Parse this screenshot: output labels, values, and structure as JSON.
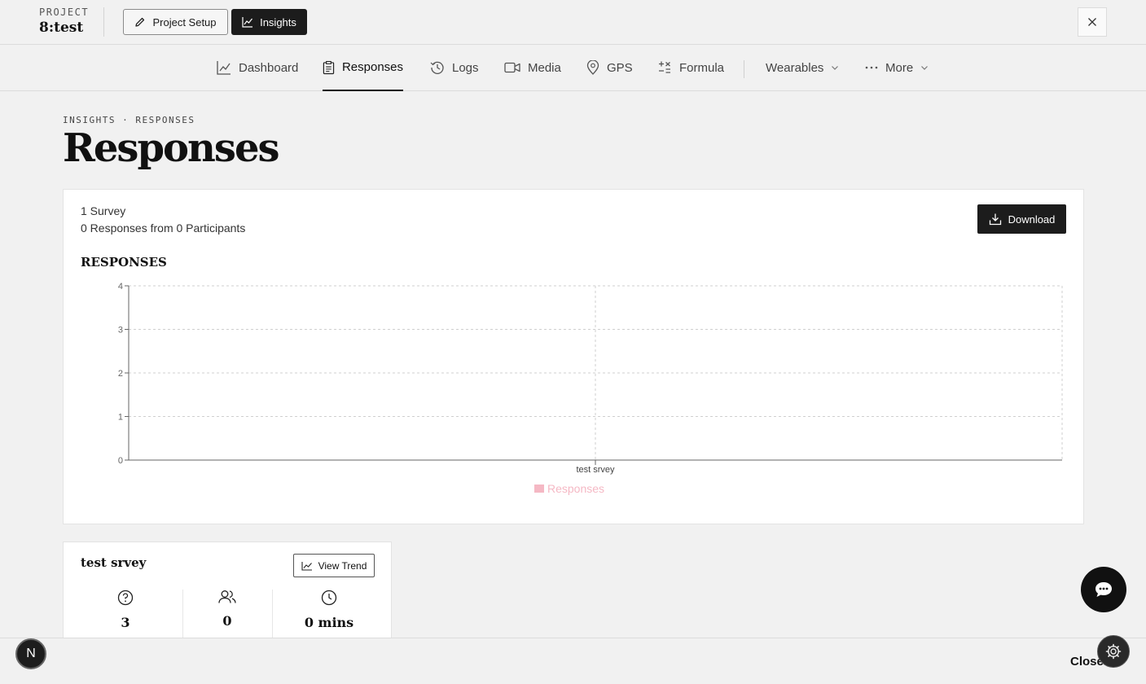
{
  "header": {
    "project_label": "PROJECT",
    "project_name": "8:test",
    "setup_label": "Project Setup",
    "insights_label": "Insights"
  },
  "nav": {
    "items": [
      {
        "label": "Dashboard",
        "icon": "line-chart-icon"
      },
      {
        "label": "Responses",
        "icon": "clipboard-icon",
        "active": true
      },
      {
        "label": "Logs",
        "icon": "history-icon"
      },
      {
        "label": "Media",
        "icon": "video-icon"
      },
      {
        "label": "GPS",
        "icon": "map-pin-icon"
      },
      {
        "label": "Formula",
        "icon": "formula-icon"
      },
      {
        "label": "Wearables",
        "icon": "chevron-down-icon"
      },
      {
        "label": "More",
        "icon": "ellipsis-icon"
      }
    ]
  },
  "page": {
    "breadcrumb": "INSIGHTS · RESPONSES",
    "title": "Responses"
  },
  "summary": {
    "surveys": "1 Survey",
    "responses": "0 Responses from 0 Participants",
    "download_label": "Download"
  },
  "chart_title": "RESPONSES",
  "chart_data": {
    "type": "bar",
    "categories": [
      "test srvey"
    ],
    "series": [
      {
        "name": "Responses",
        "values": [
          0
        ],
        "color": "#f5b8c4"
      }
    ],
    "ylim": [
      0,
      4
    ],
    "yticks": [
      "0",
      "1",
      "2",
      "3",
      "4"
    ],
    "grid": true,
    "legend": "bottom-center"
  },
  "survey_card": {
    "title": "test srvey",
    "trend_label": "View Trend",
    "stats": [
      {
        "icon": "question-circle-icon",
        "value": "3"
      },
      {
        "icon": "users-icon",
        "value": "0"
      },
      {
        "icon": "clock-icon",
        "value": "0 mins"
      }
    ]
  },
  "footer": {
    "close_label": "Close",
    "badge_letter": "N"
  },
  "colors": {
    "dark": "#1c1c1c",
    "background": "#f1f1f1",
    "legend_pink": "#f5b8c4"
  }
}
